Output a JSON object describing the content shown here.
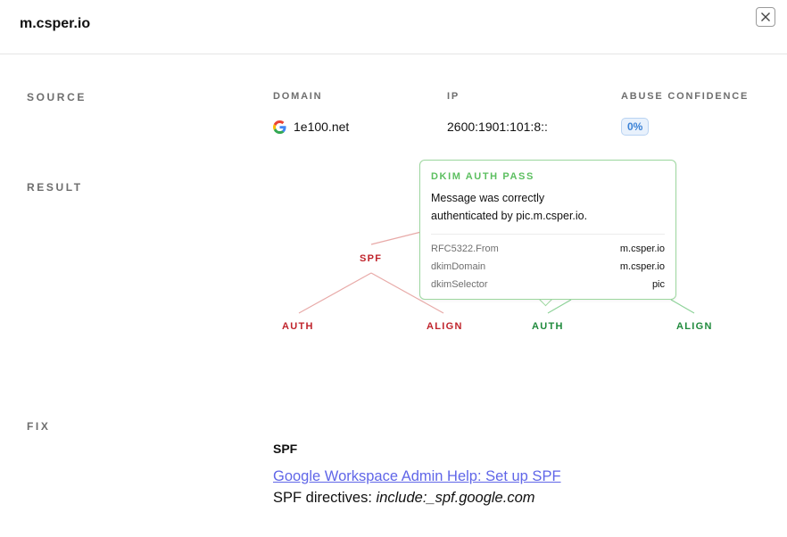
{
  "header": {
    "title": "m.csper.io",
    "close_icon": "close-icon"
  },
  "sections": {
    "source": "SOURCE",
    "result": "RESULT",
    "fix": "FIX"
  },
  "source": {
    "domain_label": "DOMAIN",
    "ip_label": "IP",
    "abuse_label": "ABUSE CONFIDENCE",
    "domain_icon": "google-icon",
    "domain_value": "1e100.net",
    "ip_value": "2600:1901:101:8::",
    "abuse_value": "0%"
  },
  "result": {
    "spf_label": "SPF",
    "spf_auth": "AUTH",
    "spf_align": "ALIGN",
    "dkim_auth": "AUTH",
    "dkim_align": "ALIGN",
    "colors": {
      "fail": "#c0242c",
      "pass": "#1f8a3c",
      "fail_line": "#e8aaa8",
      "pass_line": "#8fd39a"
    },
    "tooltip": {
      "title": "DKIM AUTH PASS",
      "message": "Message was correctly authenticated by pic.m.csper.io.",
      "rows": [
        {
          "key": "RFC5322.From",
          "value": "m.csper.io"
        },
        {
          "key": "dkimDomain",
          "value": "m.csper.io"
        },
        {
          "key": "dkimSelector",
          "value": "pic"
        }
      ]
    }
  },
  "fix": {
    "heading": "SPF",
    "link_text": "Google Workspace Admin Help: Set up SPF",
    "directive_label": "SPF directives: ",
    "directive_value": "include:_spf.google.com"
  }
}
